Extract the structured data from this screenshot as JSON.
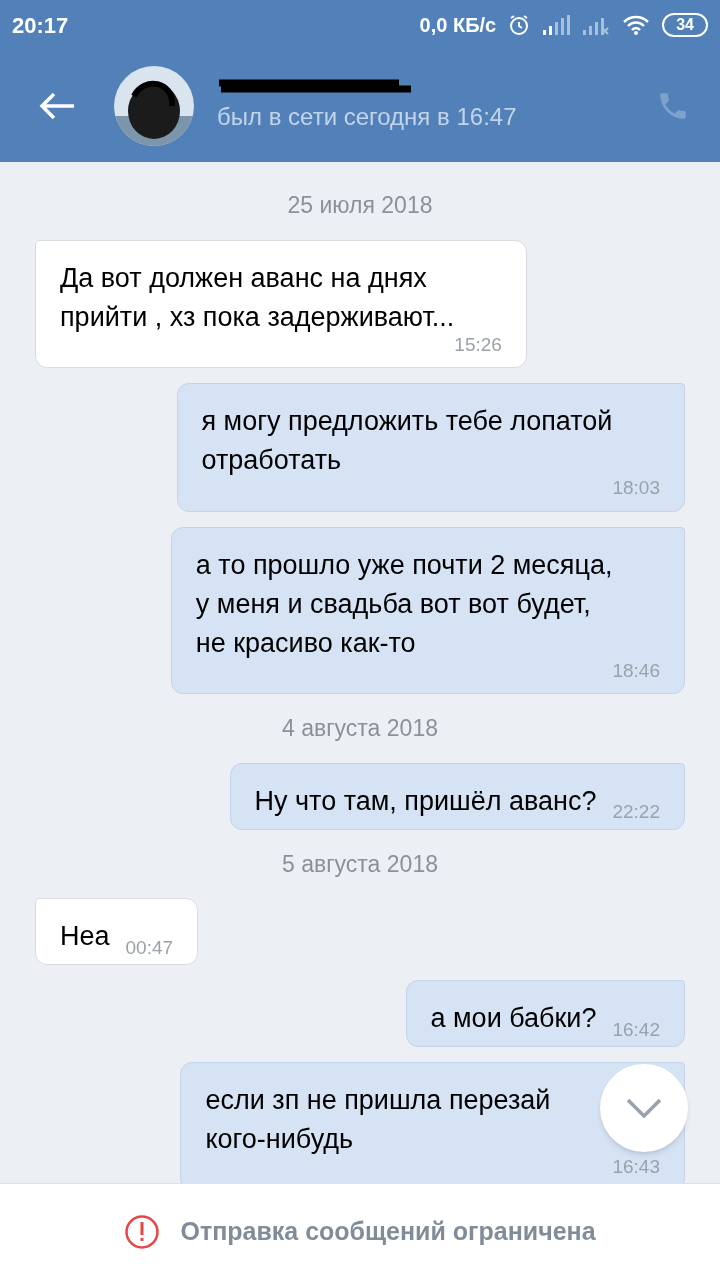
{
  "status_bar": {
    "time": "20:17",
    "speed": "0,0 КБ/с",
    "battery": "34"
  },
  "header": {
    "status": "был в сети сегодня в 16:47"
  },
  "messages": [
    {
      "kind": "date",
      "text": "25 июля 2018"
    },
    {
      "kind": "incoming",
      "text": "Да вот должен аванс на днях\nприйти , хз пока задерживают...",
      "time": "15:26"
    },
    {
      "kind": "outgoing",
      "text": "я могу предложить тебе лопатой\nотработать",
      "time": "18:03"
    },
    {
      "kind": "outgoing",
      "text": "а то прошло уже почти 2 месяца,\nу меня и свадьба вот вот будет,\nне красиво как-то",
      "time": "18:46"
    },
    {
      "kind": "date",
      "text": "4 августа 2018"
    },
    {
      "kind": "outgoing",
      "text": "Ну что там, пришёл аванс?",
      "time": "22:22"
    },
    {
      "kind": "date",
      "text": "5 августа 2018"
    },
    {
      "kind": "incoming",
      "text": "Неа",
      "time": "00:47"
    },
    {
      "kind": "outgoing",
      "text": "а мои бабки?",
      "time": "16:42"
    },
    {
      "kind": "outgoing",
      "text": "если зп не пришла перезай\nкого-нибудь",
      "time": "16:43",
      "under_scroll_button": true
    }
  ],
  "notice": "Отправка сообщений ограничена"
}
